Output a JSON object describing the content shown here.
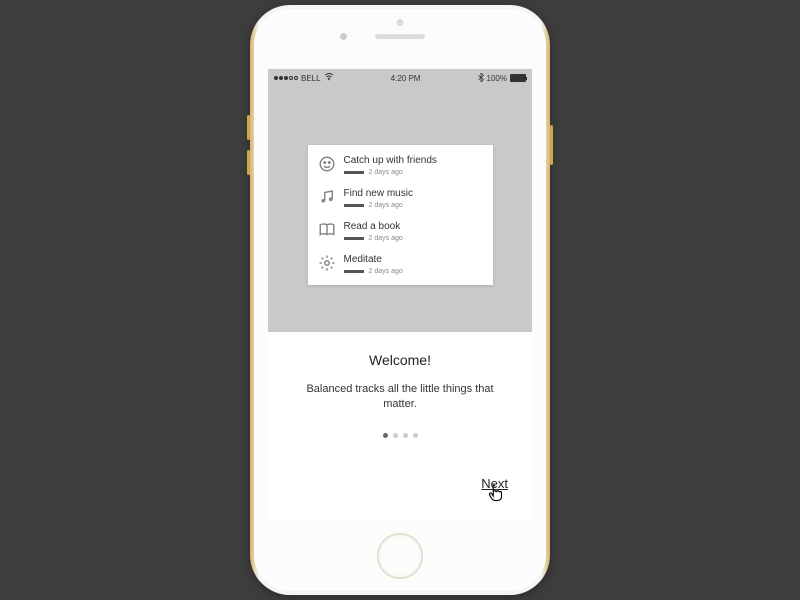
{
  "status_bar": {
    "carrier": "BELL",
    "time": "4:20 PM",
    "battery_pct": "100%",
    "bluetooth": true
  },
  "tasks": [
    {
      "icon": "smile-icon",
      "title": "Catch up with friends",
      "time": "2 days ago"
    },
    {
      "icon": "music-icon",
      "title": "Find new music",
      "time": "2 days ago"
    },
    {
      "icon": "book-icon",
      "title": "Read a book",
      "time": "2 days ago"
    },
    {
      "icon": "gear-icon",
      "title": "Meditate",
      "time": "2 days ago"
    }
  ],
  "welcome": {
    "title": "Welcome!",
    "subtitle": "Balanced tracks all the little things that matter."
  },
  "pager": {
    "total": 4,
    "active": 0
  },
  "next_label": "Next"
}
